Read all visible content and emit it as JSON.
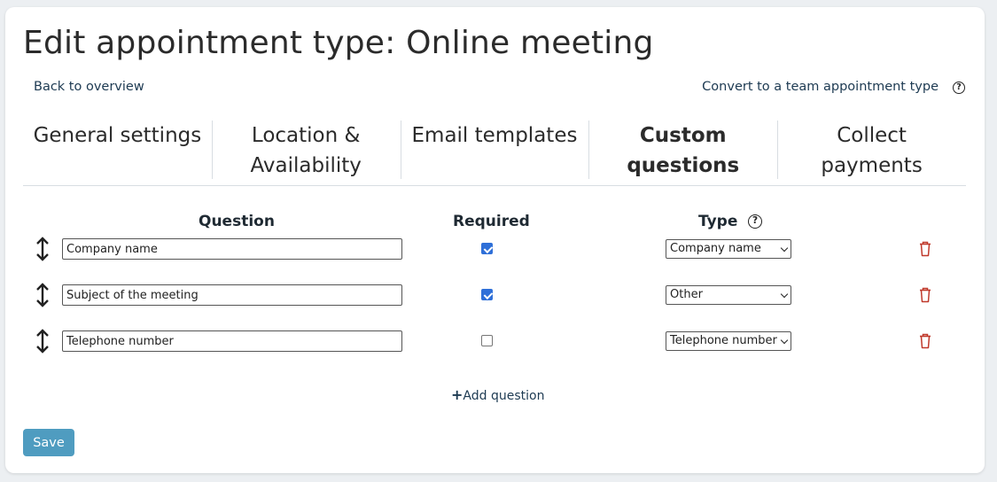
{
  "header": {
    "title": "Edit appointment type: Online meeting",
    "back_link": "Back to overview",
    "convert_link": "Convert to a team appointment type",
    "help_glyph": "?"
  },
  "tabs": [
    {
      "label_line1": "General settings",
      "label_line2": "",
      "active": false
    },
    {
      "label_line1": "Location &",
      "label_line2": "Availability",
      "active": false
    },
    {
      "label_line1": "Email templates",
      "label_line2": "",
      "active": false
    },
    {
      "label_line1": "Custom",
      "label_line2": "questions",
      "active": true
    },
    {
      "label_line1": "Collect",
      "label_line2": "payments",
      "active": false
    }
  ],
  "table": {
    "headers": {
      "question": "Question",
      "required": "Required",
      "type": "Type"
    },
    "rows": [
      {
        "question": "Company name",
        "required": true,
        "type": "Company name"
      },
      {
        "question": "Subject of the meeting",
        "required": true,
        "type": "Other"
      },
      {
        "question": "Telephone number",
        "required": false,
        "type": "Telephone number"
      }
    ]
  },
  "actions": {
    "add_question_plus": "+",
    "add_question": "Add question",
    "save": "Save"
  },
  "colors": {
    "accent_button": "#4f9cc0",
    "checkbox_checked": "#2e6fd8",
    "trash_icon": "#c0392b",
    "link": "#1d3a52"
  },
  "icons": {
    "drag_handle": "up-down-arrow-icon",
    "delete": "trash-icon",
    "help": "question-circle-icon",
    "select_caret": "chevron-down-icon"
  }
}
